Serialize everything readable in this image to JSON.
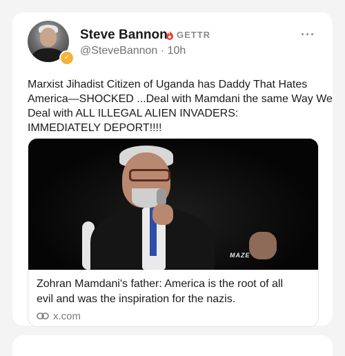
{
  "post": {
    "author_name": "Steve Bannon",
    "platform_label": "GETTR",
    "handle": "@SteveBannon",
    "separator": "·",
    "time_ago": "10h",
    "badge_glyph": "✓",
    "more_label": "···",
    "text_lines": [
      "Marxist Jihadist Citizen of Uganda has Daddy That Hates",
      "America—SHOCKED ...Deal with Mamdani the same Way We",
      "Deal with ALL ILLEGAL ALIEN INVADERS:",
      "IMMEDIATELY DEPORT!!!!"
    ]
  },
  "media": {
    "watermark": "MAZE",
    "link_title_lines": [
      "Zohran Mamdani's father: America is the root of all",
      "evil and was the inspiration for the nazis."
    ],
    "link_domain": "x.com",
    "link_icon": "link-icon"
  },
  "colors": {
    "accent_red": "#e8402f",
    "badge_gold": "#f3b43a",
    "muted_text": "#707070"
  }
}
